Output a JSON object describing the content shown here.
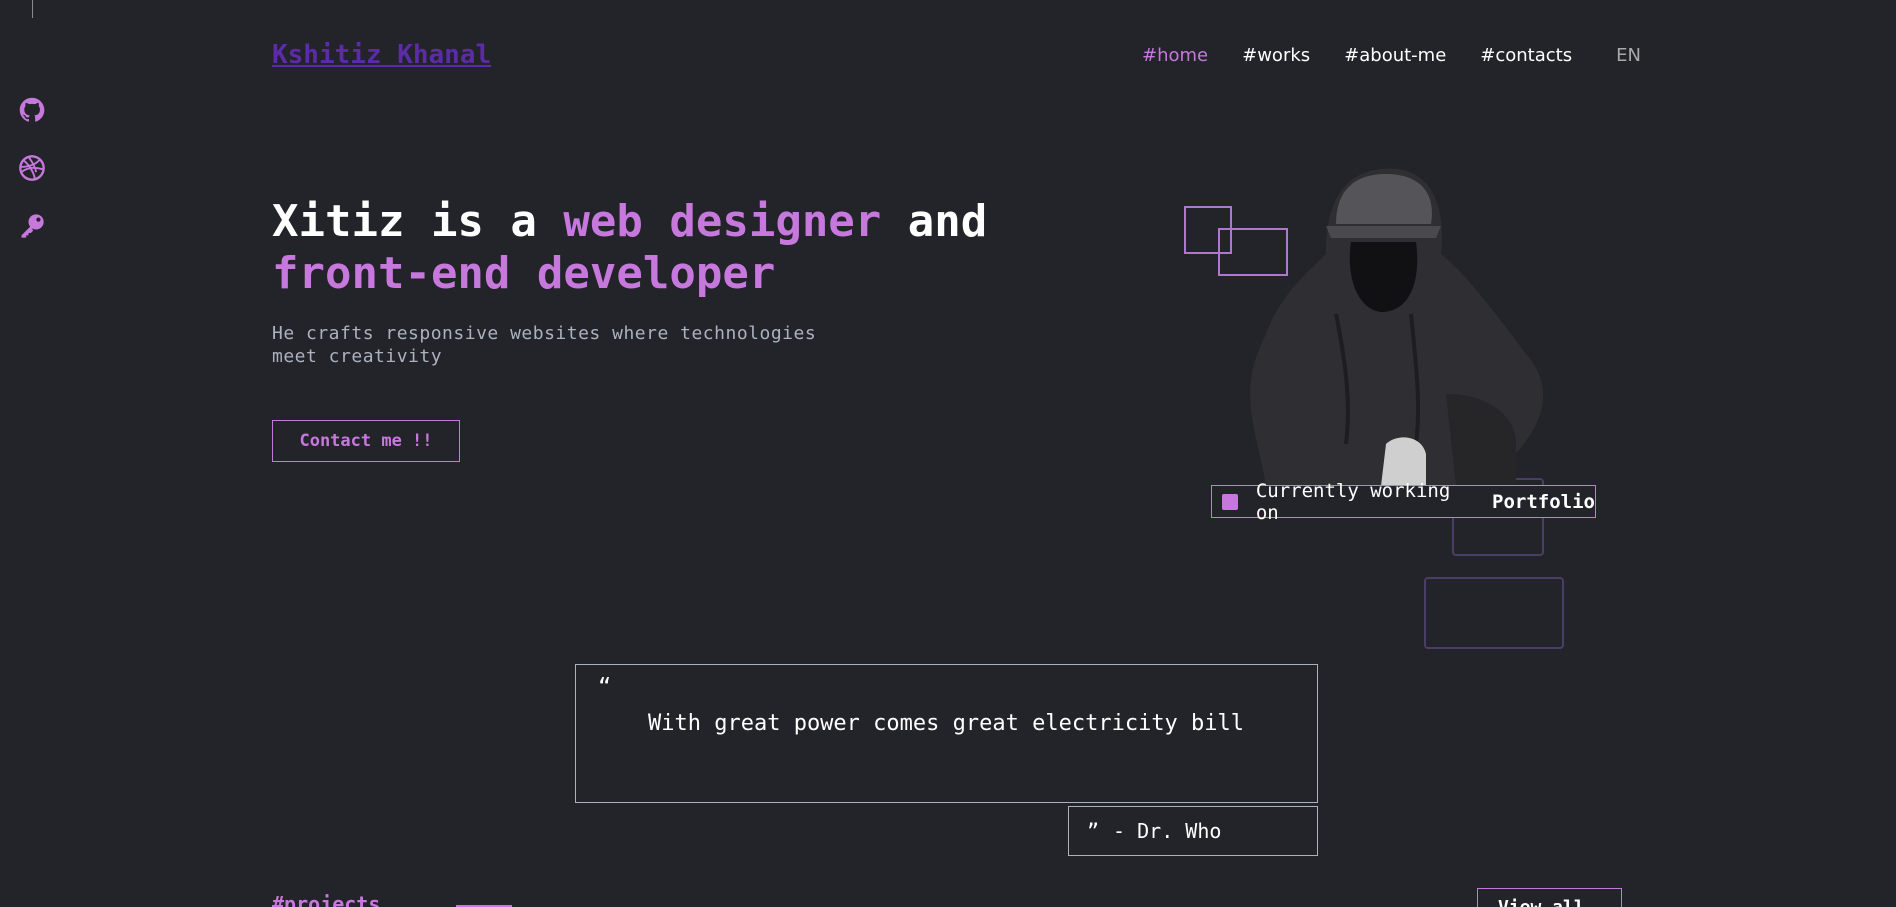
{
  "logo": "Kshitiz Khanal",
  "nav": {
    "home": "#home",
    "works": "#works",
    "about": "#about-me",
    "contacts": "#contacts",
    "lang": "EN"
  },
  "social": [
    "github-icon",
    "dribbble-icon",
    "key-icon"
  ],
  "hero": {
    "title_1": "Xitiz is a ",
    "title_accent_1": "web designer",
    "title_2": " and",
    "title_accent_2": "front-end developer",
    "subtitle": "He crafts responsive websites where technologies meet creativity",
    "cta": "Contact me !!"
  },
  "status": {
    "prefix": "Currently working on",
    "project": "Portfolio"
  },
  "quote": {
    "open_mark": "“",
    "text": "With great power comes great electricity bill",
    "close_mark": "”",
    "author": "- Dr. Who"
  },
  "projects": {
    "heading": "#projects",
    "view_all": "View all ~~>"
  },
  "colors": {
    "background": "#23232a",
    "accent": "#c778dd",
    "muted": "#abb2bf"
  }
}
